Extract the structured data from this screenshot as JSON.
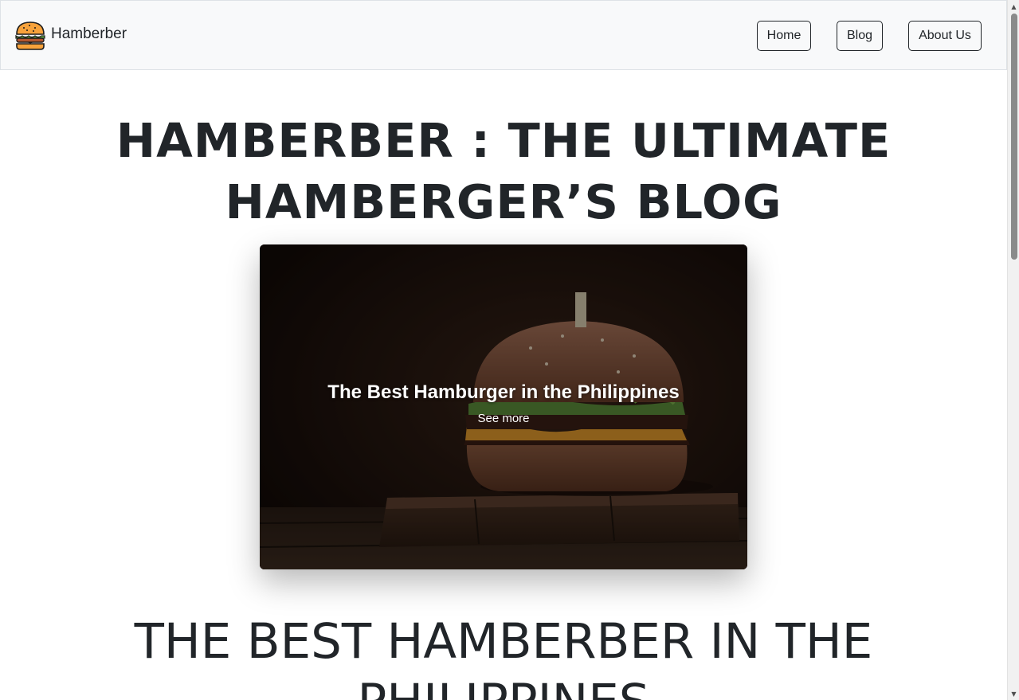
{
  "navbar": {
    "brand": {
      "name": "Hamberber",
      "logo_icon": "burger-icon"
    },
    "links": [
      {
        "label": "Home"
      },
      {
        "label": "Blog"
      },
      {
        "label": "About Us"
      }
    ]
  },
  "hero": {
    "title_line1": "HAMBERBER : THE ULTIMATE",
    "title_line2": "HAMBERGER’S BLOG"
  },
  "featured_card": {
    "title": "The Best Hamburger in the Philippines",
    "link_label": "See more",
    "image_icon": "burger-photo"
  },
  "section": {
    "title": "THE BEST HAMBERBER IN THE PHILIPPINES"
  },
  "colors": {
    "navbar_bg": "#f8f9fa",
    "text": "#212529",
    "card_overlay": "#1a0f0b"
  }
}
